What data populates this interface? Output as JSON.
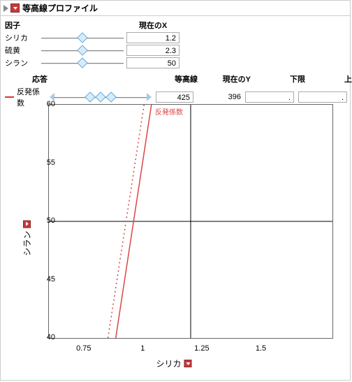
{
  "title": "等高線プロファイル",
  "factors": {
    "header_factor": "因子",
    "header_currentX": "現在のX",
    "rows": [
      {
        "name": "シリカ",
        "value": "1.2",
        "thumb": 50
      },
      {
        "name": "硫黄",
        "value": "2.3",
        "thumb": 50
      },
      {
        "name": "シラン",
        "value": "50",
        "thumb": 50
      }
    ]
  },
  "response_hdr": {
    "resp": "応答",
    "contour": "等高線",
    "currentY": "現在のY",
    "lo": "下限",
    "hi": "上限"
  },
  "response": {
    "label": "反発係数",
    "contour_val": "425",
    "currentY_val": "396",
    "lo_val": ".",
    "hi_val": ".",
    "thumbs": [
      40,
      50,
      60
    ]
  },
  "chart_data": {
    "type": "contour",
    "xlabel": "シリカ",
    "ylabel": "シラン",
    "xlim": [
      0.6,
      1.8
    ],
    "ylim": [
      40,
      60
    ],
    "xticks": [
      0.75,
      1,
      1.25,
      1.5
    ],
    "yticks": [
      40,
      45,
      50,
      55,
      60
    ],
    "crosshair": {
      "x": 1.2,
      "y": 50
    },
    "annotation": "反発係数",
    "solid_line": [
      {
        "x": 0.883,
        "y": 40
      },
      {
        "x": 1.034,
        "y": 60
      }
    ],
    "dotted_line": [
      {
        "x": 0.85,
        "y": 40
      },
      {
        "x": 1.003,
        "y": 60
      }
    ]
  }
}
